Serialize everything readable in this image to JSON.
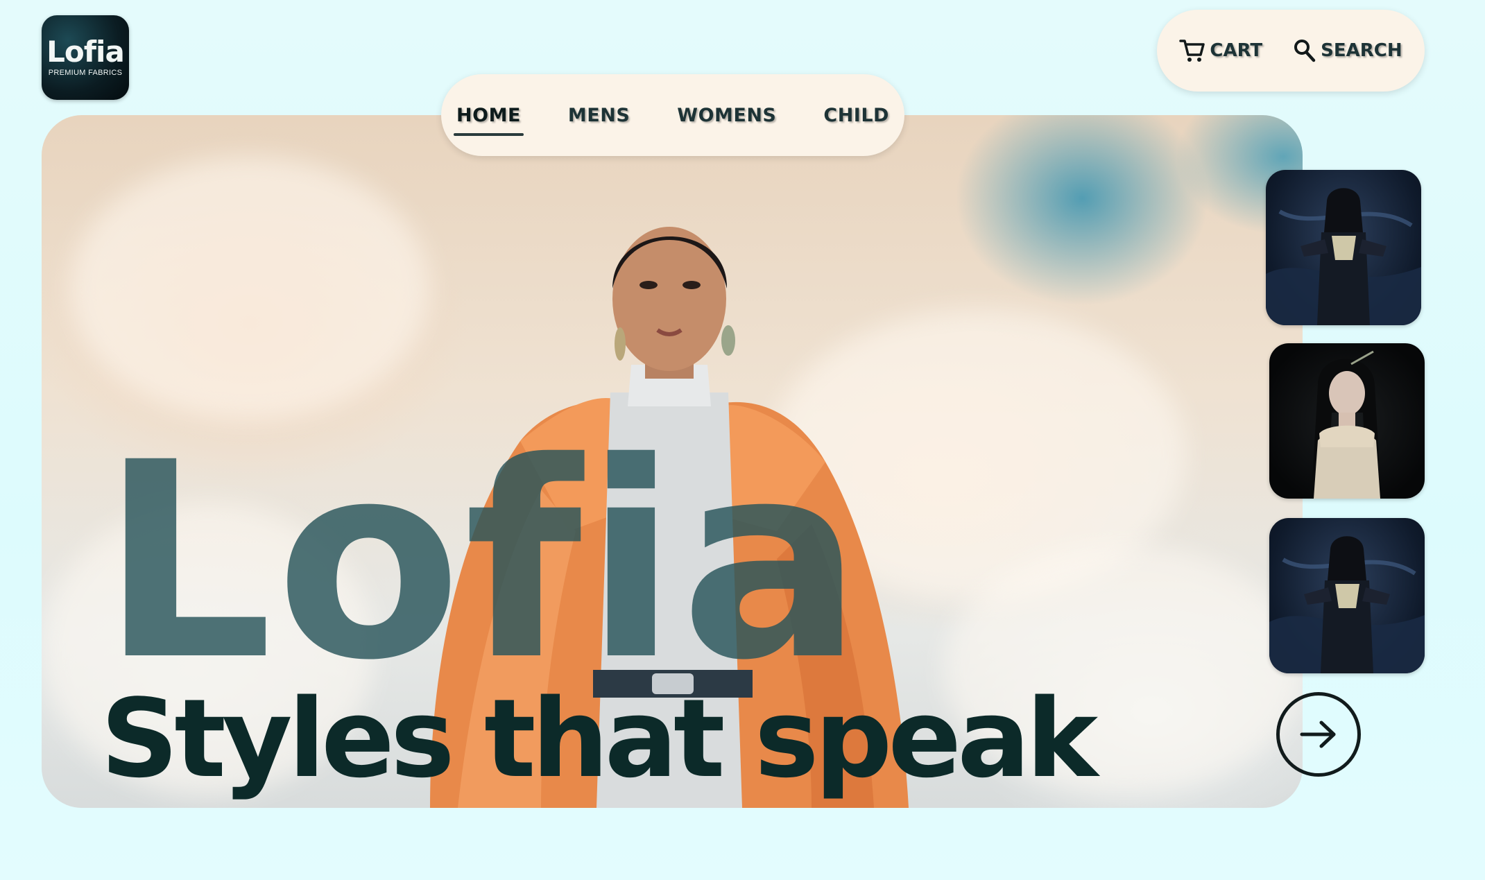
{
  "brand": {
    "logo_word": "Lofia",
    "logo_subtitle": "PREMIUM FABRICS"
  },
  "nav": {
    "items": [
      {
        "label": "HOME",
        "active": true
      },
      {
        "label": "MENS",
        "active": false
      },
      {
        "label": "WOMENS",
        "active": false
      },
      {
        "label": "CHILD",
        "active": false
      }
    ]
  },
  "utility": {
    "cart_label": "CART",
    "search_label": "SEARCH",
    "cart_icon": "cart-icon",
    "search_icon": "search-icon"
  },
  "hero": {
    "title": "Lofia",
    "tagline": "Styles that speak"
  },
  "gallery": {
    "next_icon": "arrow-right-icon"
  },
  "colors": {
    "accent_dark": "#0c2a29",
    "title_teal": "#28545a",
    "pill_background": "#fbf3e8",
    "page_background": "#e4fbfc"
  }
}
